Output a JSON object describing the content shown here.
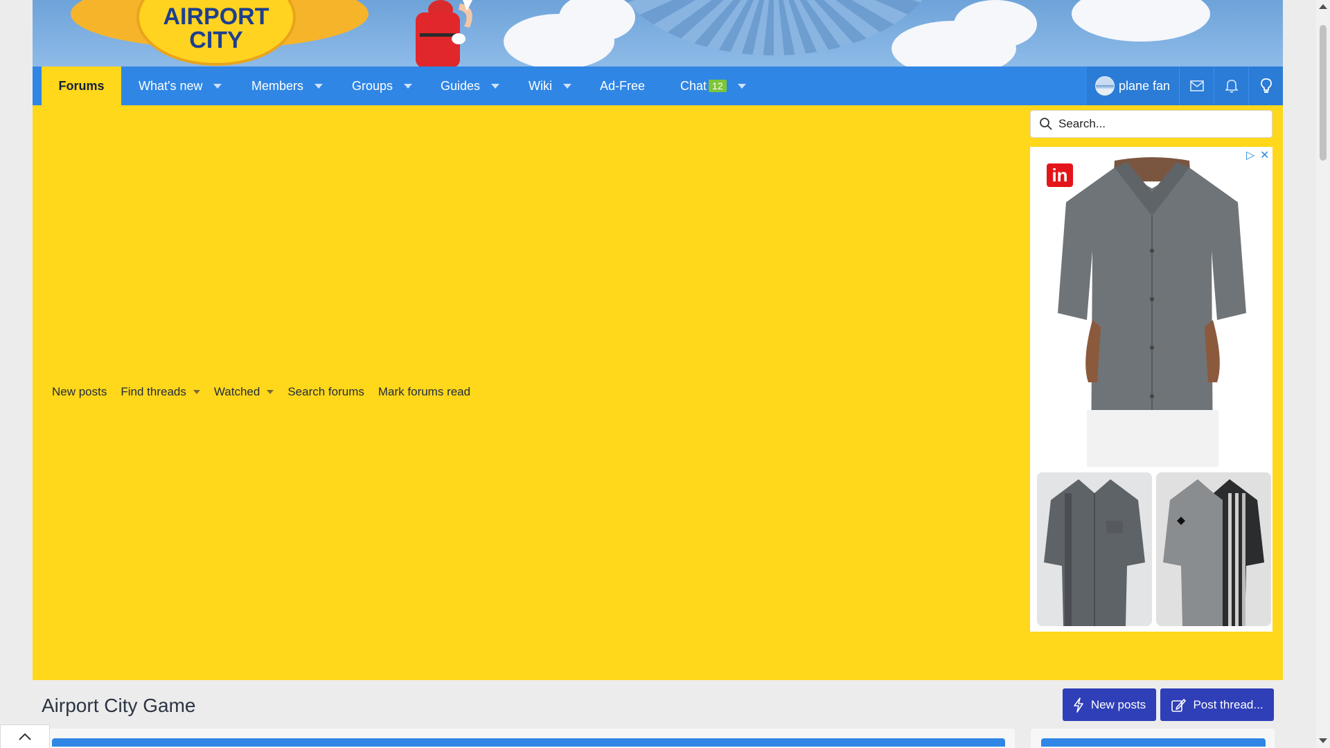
{
  "banner": {
    "logo_line1": "AIRPORT",
    "logo_line2": "CITY"
  },
  "nav": {
    "tabs": [
      {
        "label": "Forums",
        "selected": true
      },
      {
        "label": "What's new",
        "dropdown": true
      },
      {
        "label": "Members",
        "dropdown": true
      },
      {
        "label": "Groups",
        "dropdown": true
      },
      {
        "label": "Guides",
        "dropdown": true
      },
      {
        "label": "Wiki",
        "dropdown": true
      },
      {
        "label": "Ad-Free"
      },
      {
        "label": "Chat",
        "badge": "12",
        "dropdown": true
      }
    ],
    "user": {
      "name": "plane fan"
    },
    "icons": [
      "envelope-icon",
      "bell-icon",
      "lightbulb-icon"
    ]
  },
  "search": {
    "placeholder": "Search..."
  },
  "subnav": {
    "items": [
      {
        "label": "New posts"
      },
      {
        "label": "Find threads",
        "dropdown": true
      },
      {
        "label": "Watched",
        "dropdown": true
      },
      {
        "label": "Search forums"
      },
      {
        "label": "Mark forums read"
      }
    ]
  },
  "ad": {
    "logo": "in"
  },
  "page": {
    "title": "Airport City Game",
    "new_posts_button": "New posts",
    "post_thread_button": "Post thread..."
  },
  "colors": {
    "nav_blue": "#2f86e5",
    "highlight_yellow": "#ffd71b",
    "button_indigo": "#2f3fb8",
    "badge_green": "#7ec53a"
  }
}
